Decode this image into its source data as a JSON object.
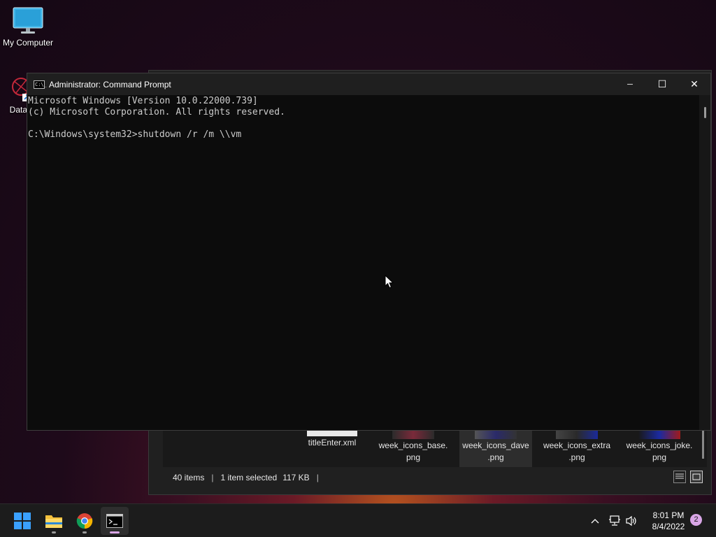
{
  "desktop": {
    "icons": [
      {
        "label": "My Computer"
      },
      {
        "label": "DataW"
      }
    ]
  },
  "explorer": {
    "files": [
      {
        "name_line1": "titleEnter.xml",
        "name_line2": ""
      },
      {
        "name_line1": "week_icons_base.",
        "name_line2": "png"
      },
      {
        "name_line1": "week_icons_dave",
        "name_line2": ".png"
      },
      {
        "name_line1": "week_icons_extra",
        "name_line2": ".png"
      },
      {
        "name_line1": "week_icons_joke.",
        "name_line2": "png"
      }
    ],
    "status": {
      "item_count": "40 items",
      "selected": "1 item selected",
      "size": "117 KB"
    }
  },
  "cmd": {
    "title": "Administrator: Command Prompt",
    "icon_glyph": "C:\\_",
    "lines": [
      "Microsoft Windows [Version 10.0.22000.739]",
      "(c) Microsoft Corporation. All rights reserved.",
      "",
      "C:\\Windows\\system32>shutdown /r /m \\\\vm"
    ],
    "controls": {
      "minimize": "─",
      "maximize": "☐",
      "close": "✕"
    }
  },
  "taskbar": {
    "apps": [
      {
        "icon": "windows-start-icon"
      },
      {
        "icon": "file-explorer-icon"
      },
      {
        "icon": "chrome-icon"
      },
      {
        "icon": "terminal-icon"
      }
    ],
    "tray": {
      "overflow_glyph": "^",
      "time": "8:01 PM",
      "date": "8/4/2022",
      "notification_count": "2"
    }
  }
}
